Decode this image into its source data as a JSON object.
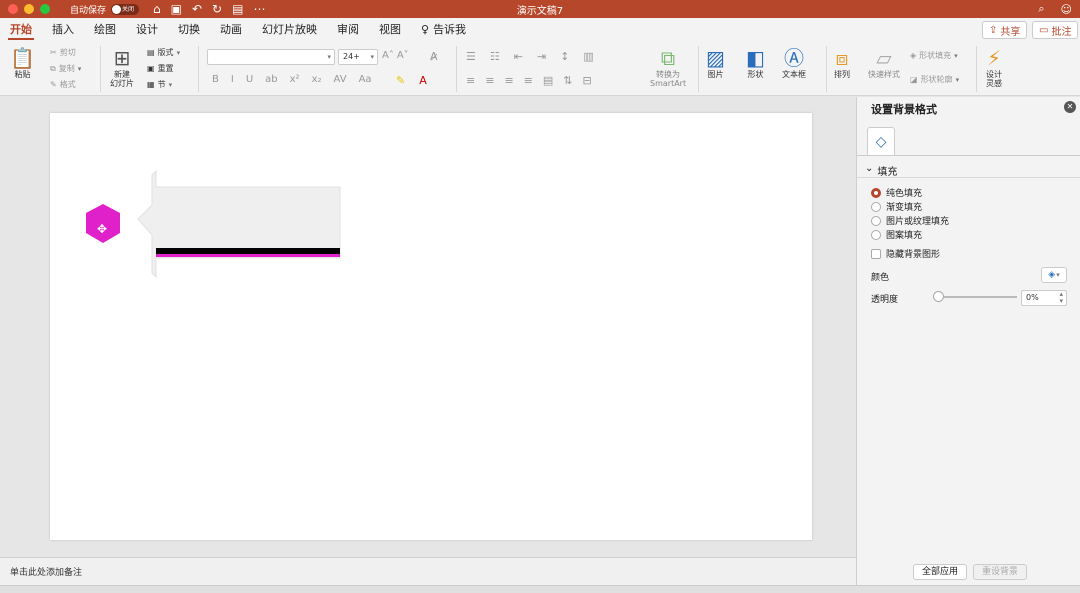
{
  "titlebar": {
    "autosave_label": "自动保存",
    "toggle_label": "关闭",
    "doc_title": "演示文稿7"
  },
  "menu": {
    "tabs": [
      "开始",
      "插入",
      "绘图",
      "设计",
      "切换",
      "动画",
      "幻灯片放映",
      "审阅",
      "视图"
    ],
    "tell_me": "告诉我",
    "share": "共享",
    "comment": "批注"
  },
  "ribbon": {
    "paste": "粘贴",
    "cut": "剪切",
    "copy": "复制",
    "format": "格式",
    "new_slide_1": "新建",
    "new_slide_2": "幻灯片",
    "layout": "版式",
    "reset": "重置",
    "section": "节",
    "font_size": "24+",
    "convert_1": "转换为",
    "convert_2": "SmartArt",
    "picture": "图片",
    "shape": "形状",
    "textbox": "文本框",
    "arrange": "排列",
    "quick_styles": "快速样式",
    "shape_fill": "形状填充",
    "shape_outline": "形状轮廓",
    "design_1": "设计",
    "design_2": "灵感"
  },
  "notes": {
    "placeholder": "单击此处添加备注"
  },
  "pane": {
    "title": "设置背景格式",
    "section": "填充",
    "options": [
      "纯色填充",
      "渐变填充",
      "图片或纹理填充",
      "图案填充"
    ],
    "hide_bg": "隐藏背景图形",
    "color_label": "颜色",
    "transparency_label": "透明度",
    "transparency_value": "0%",
    "apply_all": "全部应用",
    "reset_bg": "重设背景"
  },
  "colors": {
    "accent": "#b7472a",
    "hexagon": "#e020c8",
    "magenta_line": "#e020c8"
  }
}
